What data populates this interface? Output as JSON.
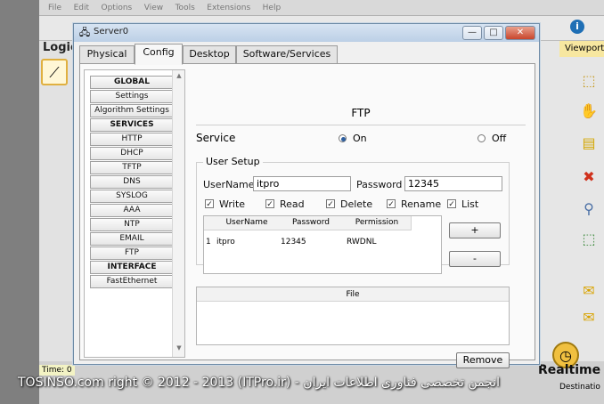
{
  "bg_app": {
    "menus": [
      "File",
      "Edit",
      "Options",
      "View",
      "Tools",
      "Extensions",
      "Help"
    ],
    "logical_label": "Logic",
    "viewport_label": "Viewport",
    "time_label": "Time: 0",
    "realtime_label": "Realtime",
    "destination_label": "Destinatio"
  },
  "window": {
    "title": "Server0",
    "minimize": "—",
    "maximize": "□",
    "close": "✕"
  },
  "tabs": [
    "Physical",
    "Config",
    "Desktop",
    "Software/Services"
  ],
  "active_tab": "Config",
  "sidebar": {
    "items": [
      {
        "label": "GLOBAL",
        "header": true
      },
      {
        "label": "Settings",
        "header": false
      },
      {
        "label": "Algorithm Settings",
        "header": false
      },
      {
        "label": "SERVICES",
        "header": true
      },
      {
        "label": "HTTP",
        "header": false
      },
      {
        "label": "DHCP",
        "header": false
      },
      {
        "label": "TFTP",
        "header": false
      },
      {
        "label": "DNS",
        "header": false
      },
      {
        "label": "SYSLOG",
        "header": false
      },
      {
        "label": "AAA",
        "header": false
      },
      {
        "label": "NTP",
        "header": false
      },
      {
        "label": "EMAIL",
        "header": false
      },
      {
        "label": "FTP",
        "header": false
      },
      {
        "label": "INTERFACE",
        "header": true
      },
      {
        "label": "FastEthernet",
        "header": false
      }
    ]
  },
  "ftp": {
    "title": "FTP",
    "service_label": "Service",
    "on_label": "On",
    "off_label": "Off",
    "service_state": "On",
    "user_setup": {
      "legend": "User Setup",
      "username_label": "UserName",
      "username_value": "itpro",
      "password_label": "Password",
      "password_value": "12345",
      "permissions": [
        {
          "label": "Write",
          "checked": true
        },
        {
          "label": "Read",
          "checked": true
        },
        {
          "label": "Delete",
          "checked": true
        },
        {
          "label": "Rename",
          "checked": true
        },
        {
          "label": "List",
          "checked": true
        }
      ],
      "table": {
        "headers": [
          "UserName",
          "Password",
          "Permission"
        ],
        "rows": [
          {
            "index": "1",
            "username": "itpro",
            "password": "12345",
            "permission": "RWDNL"
          }
        ]
      },
      "add_button": "+",
      "remove_user_button": "-"
    },
    "file_table_header": "File",
    "remove_button": "Remove"
  },
  "watermark": "TOSINSO.com right © 2012 - 2013 (ITPro.ir) - انجمن تخصصی فناوری اطلاعات ایران"
}
